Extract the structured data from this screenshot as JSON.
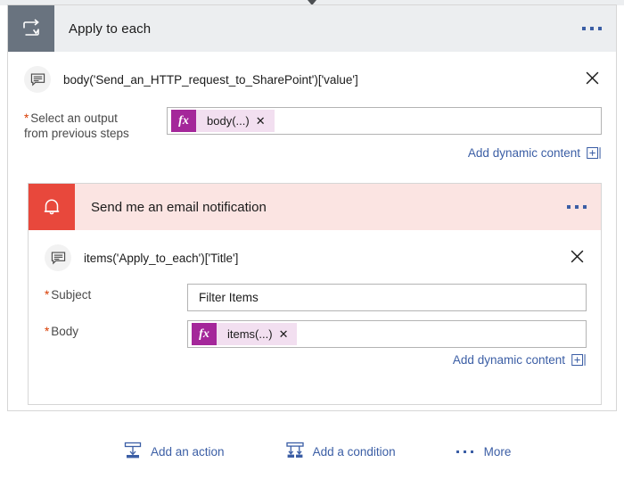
{
  "colors": {
    "loop_icon_bg": "#69737f",
    "loop_header_bg": "#eceef0",
    "email_icon_bg": "#e8483c",
    "email_header_bg": "#fbe4e2",
    "token_fx_bg": "#a4279a",
    "token_bg": "#f2dff0",
    "link_blue": "#3b5ea5",
    "required_star": "#d83b01"
  },
  "loop_action": {
    "icon": "loop-repeat-icon",
    "title": "Apply to each",
    "menu": "ellipsis-menu",
    "dynamic_expression": {
      "icon": "comment-bubble-icon",
      "text": "body('Send_an_HTTP_request_to_SharePoint')['value']",
      "close": "✕"
    },
    "field": {
      "required_mark": "*",
      "label_line1": "Select an output",
      "label_line2": "from previous steps",
      "token": {
        "fx": "fx",
        "label": "body(...)",
        "remove": "✕"
      }
    },
    "add_dynamic_content": {
      "label": "Add dynamic content",
      "icon": "insert-content-icon"
    }
  },
  "email_action": {
    "icon": "bell-notification-icon",
    "title": "Send me an email notification",
    "menu": "ellipsis-menu",
    "dynamic_expression": {
      "icon": "comment-bubble-icon",
      "text": "items('Apply_to_each')['Title']",
      "close": "✕"
    },
    "fields": [
      {
        "required_mark": "*",
        "label": "Subject",
        "value": "Filter Items",
        "type": "text"
      },
      {
        "required_mark": "*",
        "label": "Body",
        "type": "token",
        "token": {
          "fx": "fx",
          "label": "items(...)",
          "remove": "✕"
        }
      }
    ],
    "add_dynamic_content": {
      "label": "Add dynamic content",
      "icon": "insert-content-icon"
    }
  },
  "footer_actions": [
    {
      "icon": "add-action-icon",
      "label": "Add an action"
    },
    {
      "icon": "add-condition-icon",
      "label": "Add a condition"
    },
    {
      "icon": "more-dots-icon",
      "label": "More"
    }
  ]
}
